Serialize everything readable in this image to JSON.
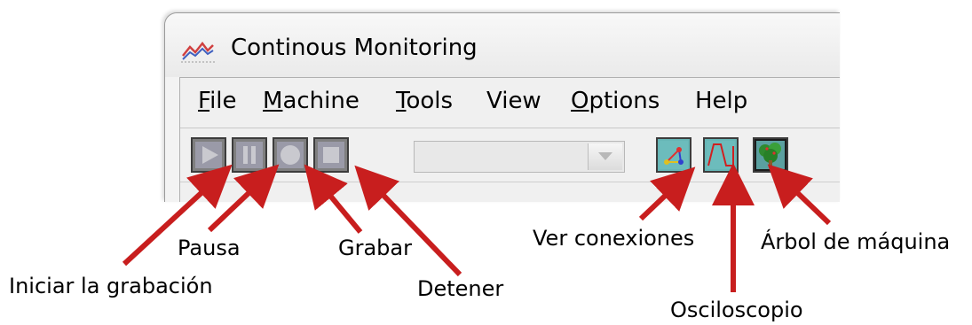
{
  "window": {
    "title": "Continous Monitoring"
  },
  "menu": {
    "items": [
      {
        "accel": "F",
        "rest": "ile"
      },
      {
        "accel": "M",
        "rest": "achine"
      },
      {
        "accel": "T",
        "rest": "ools"
      },
      {
        "accel": "",
        "rest": "View"
      },
      {
        "accel": "O",
        "rest": "ptions"
      },
      {
        "accel": "",
        "rest": "Help"
      }
    ]
  },
  "toolbar": {
    "buttons": [
      {
        "icon": "play-icon"
      },
      {
        "icon": "pause-icon"
      },
      {
        "icon": "record-icon"
      },
      {
        "icon": "stop-icon"
      },
      {
        "icon": "connections-icon"
      },
      {
        "icon": "oscilloscope-icon"
      },
      {
        "icon": "machine-tree-icon"
      }
    ],
    "dropdown_value": ""
  },
  "annotations": {
    "start_recording": "Iniciar la grabación",
    "pause": "Pausa",
    "record": "Grabar",
    "stop": "Detener",
    "view_connections": "Ver conexiones",
    "oscilloscope": "Osciloscopio",
    "machine_tree": "Árbol de máquina"
  },
  "colors": {
    "arrow": "#c81e1e",
    "button_gray": "#7f7f7f",
    "button_teal": "#66b6b6"
  }
}
